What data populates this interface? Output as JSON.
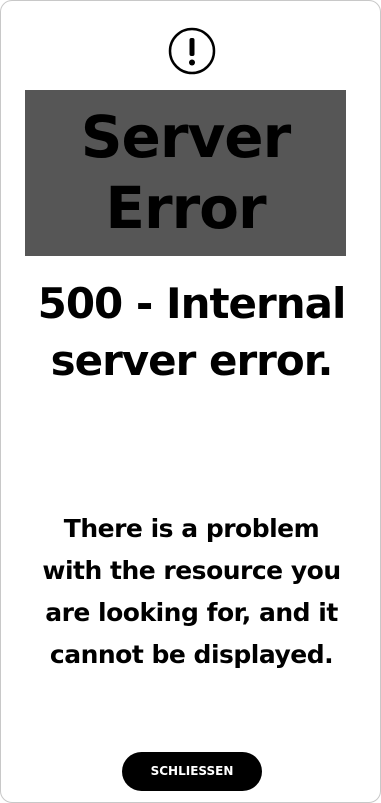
{
  "dialog": {
    "icon": "exclamation-circle-icon",
    "title": "Server Error",
    "subtitle": "500 - Internal server error.",
    "message": "There is a problem with the resource you are looking for, and it cannot be displayed.",
    "close_label": "SCHLIESSEN"
  },
  "colors": {
    "title_background": "#565656",
    "button_background": "#000000",
    "button_text": "#ffffff",
    "text": "#000000"
  }
}
